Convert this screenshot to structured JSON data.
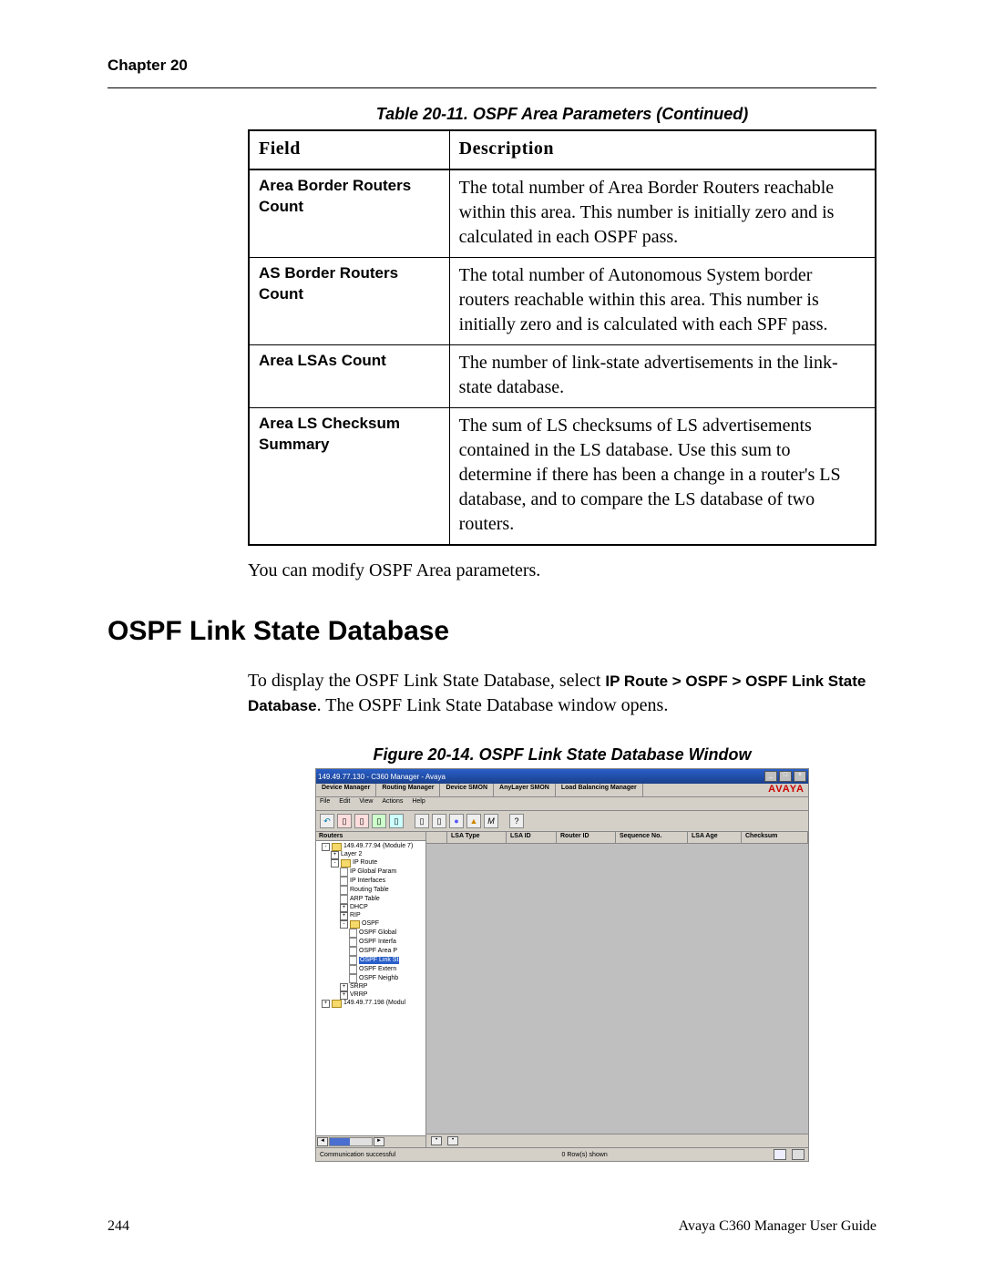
{
  "page": {
    "chapter": "Chapter 20",
    "table_caption": "Table 20-11.  OSPF Area Parameters  (Continued)",
    "table_headers": {
      "field": "Field",
      "description": "Description"
    },
    "table_rows": [
      {
        "field": "Area Border Routers Count",
        "desc": "The total number of Area Border Routers reachable within this area. This number is initially zero and is calculated in each OSPF pass."
      },
      {
        "field": "AS Border Routers Count",
        "desc": "The total number of Autonomous System border routers reachable within this area. This number is initially zero and is calculated with each SPF pass."
      },
      {
        "field": "Area LSAs Count",
        "desc": "The number of link-state advertisements in the link-state database."
      },
      {
        "field": "Area LS Checksum Summary",
        "desc": "The sum of LS checksums of LS advertisements contained in the LS database. Use this sum to determine if there has been a change in a router's LS database, and to compare the LS database of two routers."
      }
    ],
    "modify_note": "You can modify OSPF Area parameters.",
    "section_title": "OSPF Link State Database",
    "body_text_1": "To display the OSPF Link State Database, select ",
    "body_bold_1": "IP Route > OSPF > OSPF Link State Database",
    "body_text_2": ". The OSPF Link State Database window opens.",
    "figure_caption": "Figure 20-14.  OSPF Link State Database Window",
    "page_number": "244",
    "doc_title": "Avaya C360 Manager User Guide"
  },
  "screenshot": {
    "window_title": "149.49.77.130 - C360 Manager - Avaya",
    "brand": "AVAYA",
    "tabs": [
      "Device Manager",
      "Routing Manager",
      "Device SMON",
      "AnyLayer SMON",
      "Load Balancing Manager"
    ],
    "menu": [
      "File",
      "Edit",
      "View",
      "Actions",
      "Help"
    ],
    "tree_header": "Routers",
    "tree": {
      "root": "149.49.77.94 (Module 7)",
      "l2": "Layer 2",
      "ipr": "IP Route",
      "glob": "IP Global Param",
      "ipif": "IP Interfaces",
      "rtab": "Routing Table",
      "arpt": "ARP Table",
      "dhcp": "DHCP",
      "rip": "RIP",
      "ospf": "OSPF",
      "ospf_g": "OSPF Global",
      "ospf_i": "OSPF Interfa",
      "ospf_a": "OSPF Area P",
      "ospf_l": "OSPF Link St",
      "ospf_e": "OSPF Extern",
      "ospf_n": "OSPF Neighb",
      "srrp": "SRRP",
      "vrrp": "VRRP",
      "other": "149.49.77.198 (Modul"
    },
    "grid_cols": [
      "LSA Type",
      "LSA ID",
      "Router ID",
      "Sequence No.",
      "LSA Age",
      "Checksum"
    ],
    "status_left": "Communication successful",
    "status_mid": "0 Row(s) shown"
  }
}
